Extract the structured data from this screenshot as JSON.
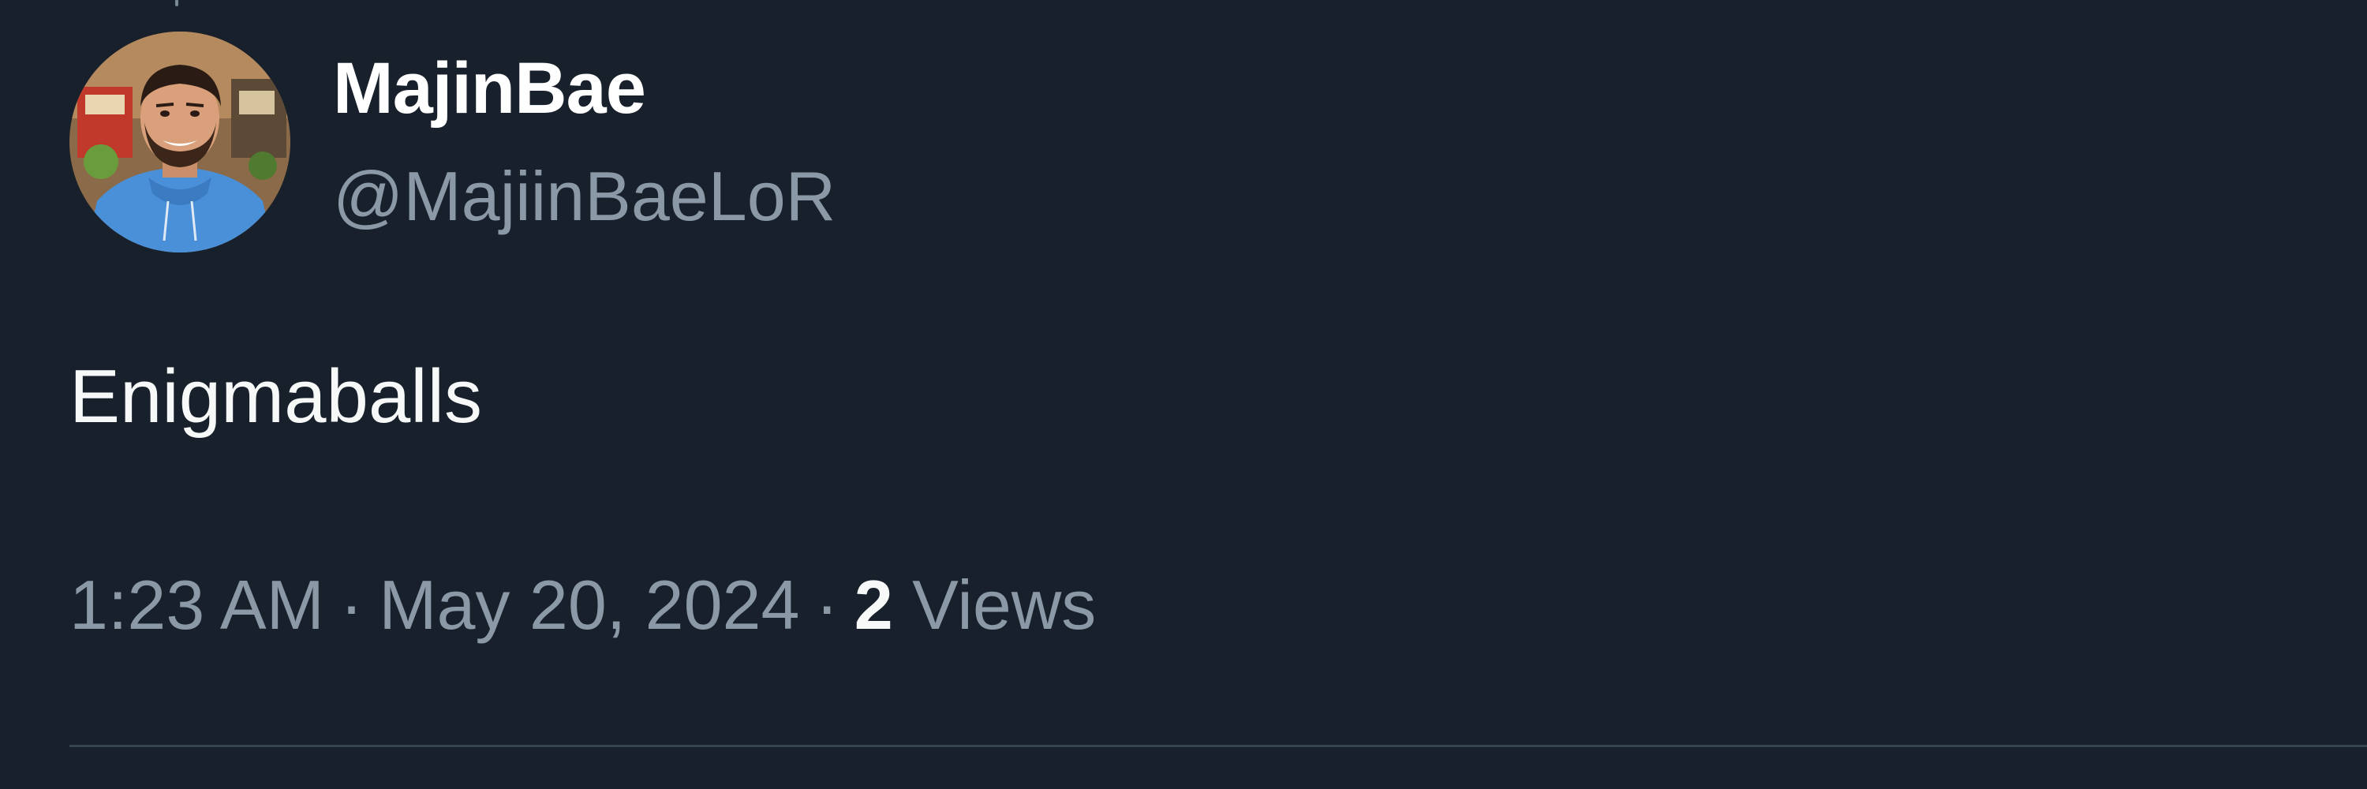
{
  "tweet": {
    "author": {
      "display_name": "MajinBae",
      "handle": "@MajiinBaeLoR",
      "avatar_icon": "user-avatar-photo"
    },
    "text": "Enigmaballs",
    "meta": {
      "time": "1:23 AM",
      "separator": "·",
      "date": "May 20, 2024",
      "views_count": "2",
      "views_label": "Views"
    }
  },
  "colors": {
    "background": "#17202b",
    "primary_text": "#f7f9f9",
    "secondary_text": "#8b98a5",
    "divider": "#38444d"
  }
}
